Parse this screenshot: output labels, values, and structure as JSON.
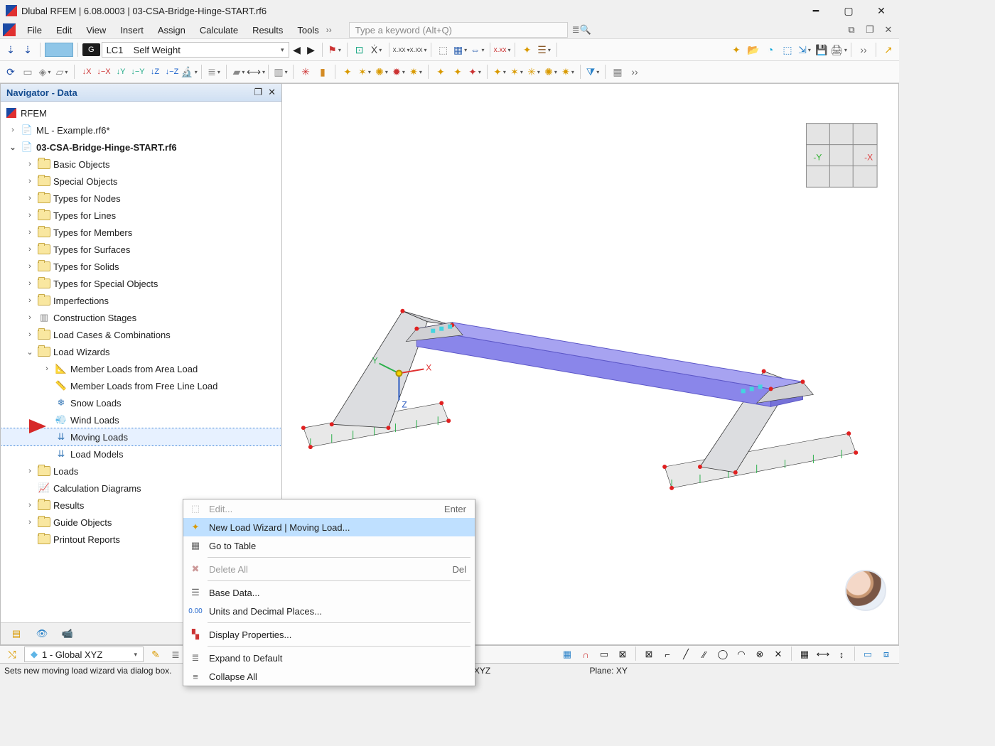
{
  "title": "Dlubal RFEM | 6.08.0003 | 03-CSA-Bridge-Hinge-START.rf6",
  "menus": [
    "File",
    "Edit",
    "View",
    "Insert",
    "Assign",
    "Calculate",
    "Results",
    "Tools"
  ],
  "search_placeholder": "Type a keyword (Alt+Q)",
  "lc": {
    "badge": "G",
    "code": "LC1",
    "name": "Self Weight"
  },
  "navigator": {
    "title": "Navigator - Data",
    "root": "RFEM",
    "file1": "ML - Example.rf6*",
    "file2": "03-CSA-Bridge-Hinge-START.rf6",
    "folders_top": [
      "Basic Objects",
      "Special Objects",
      "Types for Nodes",
      "Types for Lines",
      "Types for Members",
      "Types for Surfaces",
      "Types for Solids",
      "Types for Special Objects",
      "Imperfections",
      "Construction Stages",
      "Load Cases & Combinations",
      "Load Wizards"
    ],
    "load_wizards": [
      "Member Loads from Area Load",
      "Member Loads from Free Line Load",
      "Snow Loads",
      "Wind Loads",
      "Moving Loads",
      "Load Models"
    ],
    "folders_bottom": [
      "Loads",
      "Calculation Diagrams",
      "Results",
      "Guide Objects",
      "Printout Reports"
    ]
  },
  "context_menu": {
    "edit": "Edit...",
    "edit_shortcut": "Enter",
    "new_wizard": "New Load Wizard | Moving Load...",
    "go_to_table": "Go to Table",
    "delete_all": "Delete All",
    "delete_shortcut": "Del",
    "base_data": "Base Data...",
    "units": "Units and Decimal Places...",
    "display_props": "Display Properties...",
    "expand": "Expand to Default",
    "collapse": "Collapse All"
  },
  "bottom_combo": "1 - Global XYZ",
  "status": {
    "hint": "Sets new moving load wizard via dialog box.",
    "cs": "CS: Global XYZ",
    "plane": "Plane: XY"
  },
  "colors": {
    "highlight": "#bfe0ff",
    "accent": "#1a4aa4"
  }
}
